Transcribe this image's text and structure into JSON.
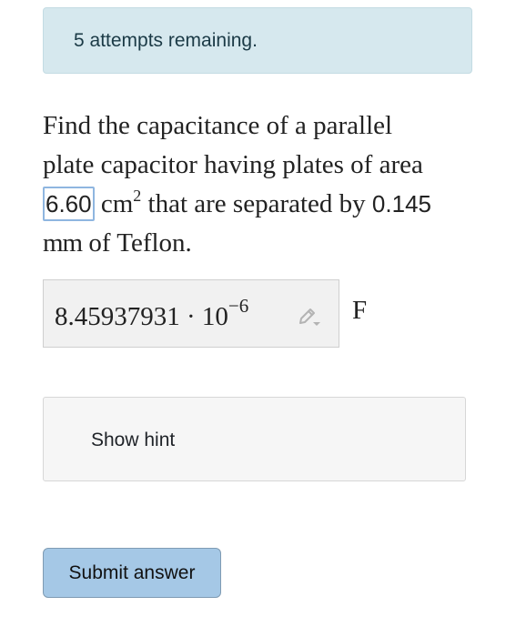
{
  "alert": {
    "text": "5 attempts remaining."
  },
  "question": {
    "line1": "Find the capacitance of a parallel",
    "line2": "plate capacitor having plates of area",
    "area_value": "6.60",
    "area_unit": "cm",
    "area_exponent": "2",
    "line3_middle": "that are separated by",
    "separation_value": "0.145",
    "separation_unit": "mm",
    "line4_end": "of Teflon."
  },
  "answer": {
    "mantissa": "8.45937931 · 10",
    "exponent": "−6",
    "unit": "F",
    "edit_icon": "pencil-icon"
  },
  "hint": {
    "label": "Show hint"
  },
  "submit": {
    "label": "Submit answer"
  },
  "colors": {
    "alert_bg": "#d6e8ee",
    "submit_bg": "#a5c8e6",
    "area_box_border": "#8fb6e0"
  }
}
